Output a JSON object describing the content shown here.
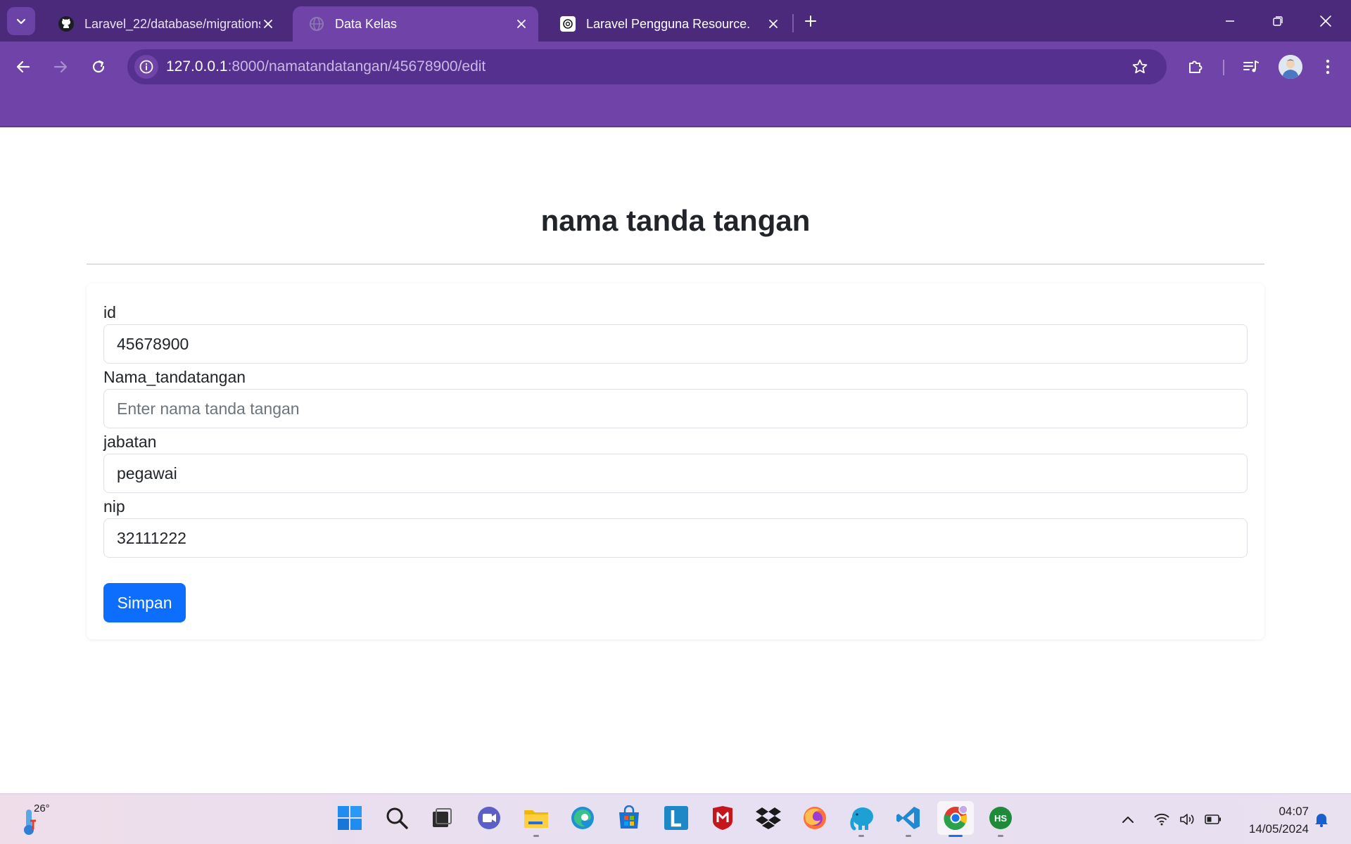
{
  "browser": {
    "tabs": [
      {
        "title": "Laravel_22/database/migrations",
        "icon": "github-icon",
        "active": false
      },
      {
        "title": "Data Kelas",
        "icon": "globe-icon",
        "active": true
      },
      {
        "title": "Laravel Pengguna Resource.",
        "icon": "chatgpt-icon",
        "active": false
      }
    ],
    "url": {
      "host": "127.0.0.1",
      "path": ":8000/namatandatangan/45678900/edit"
    }
  },
  "page": {
    "title": "nama tanda tangan",
    "form": {
      "fields": [
        {
          "label": "id",
          "value": "45678900",
          "placeholder": ""
        },
        {
          "label": "Nama_tandatangan",
          "value": "",
          "placeholder": "Enter nama tanda tangan"
        },
        {
          "label": "jabatan",
          "value": "pegawai",
          "placeholder": ""
        },
        {
          "label": "nip",
          "value": "32111222",
          "placeholder": ""
        }
      ],
      "submit_label": "Simpan"
    }
  },
  "taskbar": {
    "weather_temp": "26°",
    "apps": [
      "windows-start-icon",
      "search-icon",
      "task-view-icon",
      "meet-icon",
      "file-explorer-icon",
      "edge-icon",
      "store-icon",
      "l-app-icon",
      "mcafee-icon",
      "dropbox-icon",
      "firefox-icon",
      "elephant-app-icon",
      "vscode-icon",
      "chrome-icon",
      "hs-app-icon"
    ],
    "clock": {
      "time": "04:07",
      "date": "14/05/2024"
    }
  },
  "colors": {
    "chrome_dark": "#4b2a7b",
    "chrome_toolbar": "#6f43a8",
    "primary_button": "#0d6efd"
  }
}
